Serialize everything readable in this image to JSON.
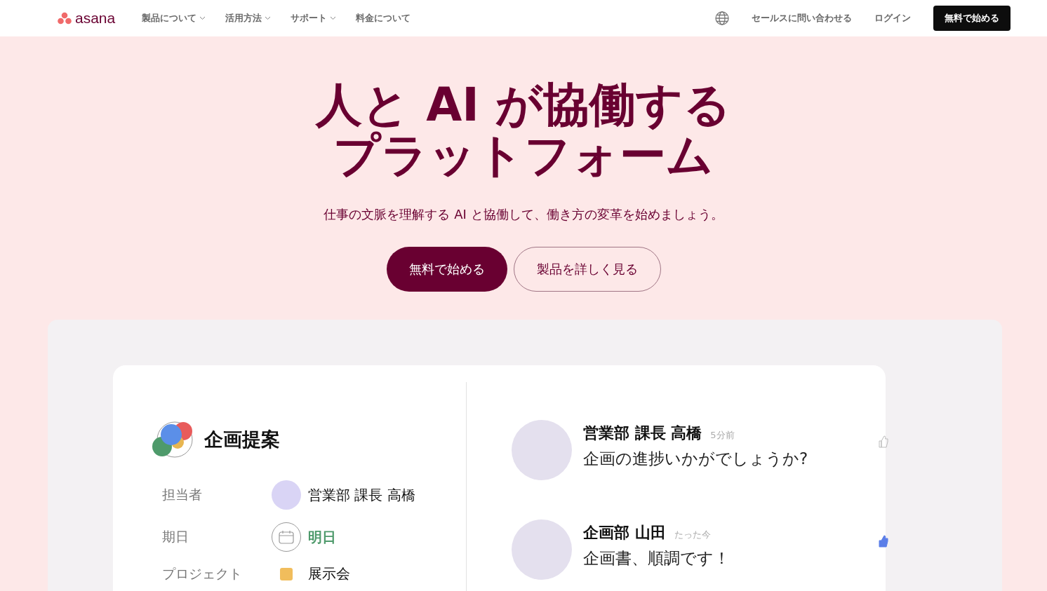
{
  "header": {
    "logo": "asana",
    "nav": [
      {
        "label": "製品について",
        "dropdown": true
      },
      {
        "label": "活用方法",
        "dropdown": true
      },
      {
        "label": "サポート",
        "dropdown": true
      },
      {
        "label": "料金について",
        "dropdown": false
      }
    ],
    "contact": "セールスに問い合わせる",
    "login": "ログイン",
    "cta": "無料で始める"
  },
  "hero": {
    "title_lines": [
      "人と AI が協働する",
      "プラットフォーム"
    ],
    "subtitle": "仕事の文脈を理解する AI と協働して、働き方の変革を始めましょう。",
    "primary_button": "無料で始める",
    "secondary_button": "製品を詳しく見る"
  },
  "task": {
    "title": "企画提案",
    "fields": [
      {
        "kind": "person",
        "label": "担当者",
        "value": "営業部 課長 高橋"
      },
      {
        "kind": "date",
        "label": "期日",
        "value": "明日"
      },
      {
        "kind": "project",
        "label": "プロジェクト",
        "value": "展示会",
        "color": "#f1bd5c"
      }
    ]
  },
  "comments": [
    {
      "author": "営業部 課長 高橋",
      "time": "5分前",
      "text": "企画の進捗いかがでしょうか?",
      "liked": false
    },
    {
      "author": "企画部 山田",
      "time": "たった今",
      "text": "企画書、順調です！",
      "liked": true
    }
  ]
}
